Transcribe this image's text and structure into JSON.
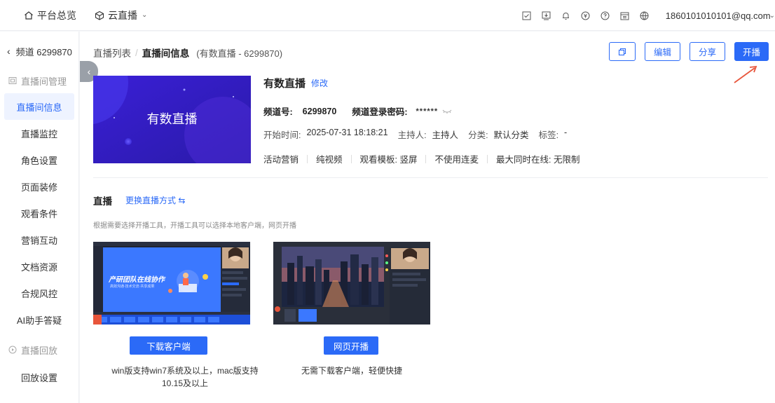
{
  "topbar": {
    "nav": [
      {
        "label": "平台总览",
        "icon": "home-icon"
      },
      {
        "label": "云直播",
        "icon": "cube-icon"
      }
    ],
    "account": "18601010101​01@qq.com"
  },
  "sidebar": {
    "back_label": "频道 6299870",
    "group1": "直播间管理",
    "items": [
      {
        "label": "直播间信息",
        "active": true
      },
      {
        "label": "直播监控"
      },
      {
        "label": "角色设置"
      },
      {
        "label": "页面装修"
      },
      {
        "label": "观看条件"
      },
      {
        "label": "营销互动"
      },
      {
        "label": "文档资源"
      },
      {
        "label": "合规风控"
      },
      {
        "label": "AI助手答疑"
      }
    ],
    "group2": "直播回放",
    "items2": [
      {
        "label": "回放设置"
      }
    ]
  },
  "breadcrumb": {
    "list": "直播列表",
    "current": "直播间信息",
    "extra": "(有数直播 - 6299870)"
  },
  "buttons": {
    "edit": "编辑",
    "share": "分享",
    "start": "开播"
  },
  "cover": {
    "title": "有数直播"
  },
  "info": {
    "title": "有数直播",
    "modify": "修改",
    "channel_label": "频道号:",
    "channel_value": "6299870",
    "password_label": "频道登录密码:",
    "password_value": "******",
    "start_label": "开始时间:",
    "start_value": "2025-07-31 18:18:21",
    "host_label": "主持人:",
    "host_value": "主持人",
    "category_label": "分类:",
    "category_value": "默认分类",
    "tag_label": "标签:",
    "tag_value": "-",
    "features": [
      "活动营销",
      "纯视频",
      "观看模板: 竖屏",
      "不使用连麦",
      "最大同时在线: 无限制"
    ]
  },
  "live": {
    "title": "直播",
    "switch": "更换直播方式 ⇆",
    "hint": "根据需要选择开播工具，开播工具可以选择本地客户端，网页开播"
  },
  "tools": [
    {
      "button": "下载客户端",
      "desc_line1": "win版支持win7系统及以上，mac版支持",
      "desc_line2": "10.15及以上",
      "banner_title": "产研团队在线协作",
      "banner_sub": "高效沟通·技术交流·共享成果"
    },
    {
      "button": "网页开播",
      "desc_line1": "无需下载客户端，轻便快捷"
    }
  ]
}
